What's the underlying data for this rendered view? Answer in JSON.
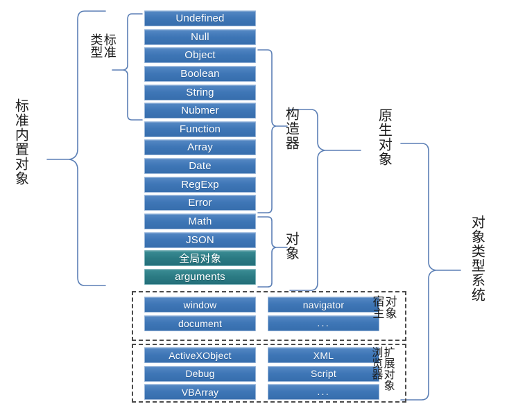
{
  "diagram": {
    "title": "对象类型系统",
    "accent_box_color": "#3e76b6",
    "accent_box_alt_color": "#2b7a83",
    "line_color": "#5b7fb5",
    "dashed_color": "#4a4a4a"
  },
  "labels": {
    "standard_builtin_objects": "标准内置对象",
    "standard_types_line1": "标准",
    "standard_types_line2": "类型",
    "constructor": "构造器",
    "object": "对象",
    "native_objects": "原生对象",
    "host_left": "对象",
    "host_right": "宿主",
    "extension_left": "扩展对象",
    "extension_right": "浏览器",
    "object_type_system": "对象类型系统"
  },
  "standard_list": [
    {
      "label": "Undefined",
      "style": "blue",
      "group": "standard_types"
    },
    {
      "label": "Null",
      "style": "blue",
      "group": "standard_types"
    },
    {
      "label": "Object",
      "style": "blue",
      "group": "standard_types_constructor"
    },
    {
      "label": "Boolean",
      "style": "blue",
      "group": "standard_types_constructor"
    },
    {
      "label": "String",
      "style": "blue",
      "group": "standard_types_constructor"
    },
    {
      "label": "Nubmer",
      "style": "blue",
      "group": "standard_types_constructor"
    },
    {
      "label": "Function",
      "style": "blue",
      "group": "constructor"
    },
    {
      "label": "Array",
      "style": "blue",
      "group": "constructor"
    },
    {
      "label": "Date",
      "style": "blue",
      "group": "constructor"
    },
    {
      "label": "RegExp",
      "style": "blue",
      "group": "constructor"
    },
    {
      "label": "Error",
      "style": "blue",
      "group": "constructor"
    },
    {
      "label": "Math",
      "style": "blue",
      "group": "object"
    },
    {
      "label": "JSON",
      "style": "blue",
      "group": "object"
    },
    {
      "label": "全局对象",
      "style": "teal",
      "group": "object"
    },
    {
      "label": "arguments",
      "style": "teal",
      "group": "object"
    }
  ],
  "host_group": {
    "left_column": [
      "window",
      "document"
    ],
    "right_column": [
      "navigator",
      "..."
    ]
  },
  "extension_group": {
    "left_column": [
      "ActiveXObject",
      "Debug",
      "VBArray"
    ],
    "right_column": [
      "XML",
      "Script",
      "..."
    ]
  }
}
